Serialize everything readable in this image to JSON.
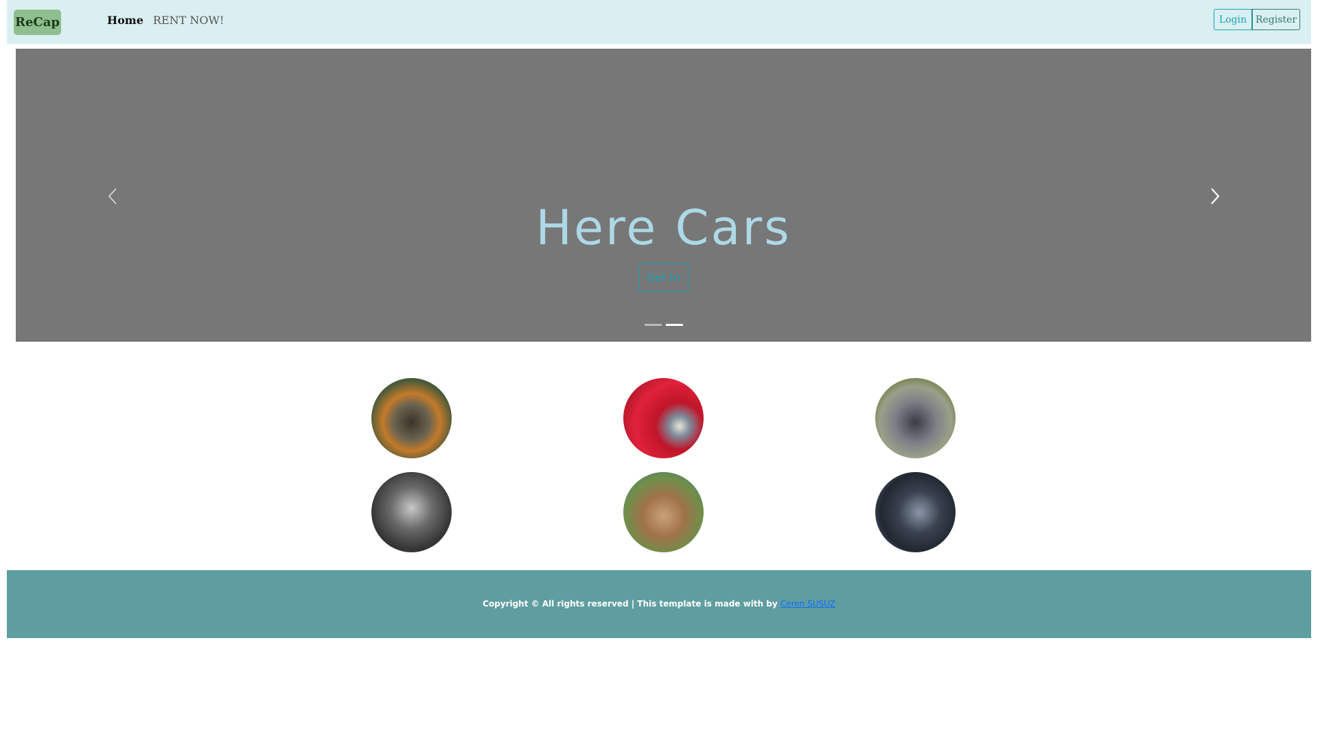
{
  "navbar": {
    "brand": "ReCap",
    "links": [
      {
        "label": "Home"
      },
      {
        "label": "RENT NOW!"
      }
    ],
    "login_label": "Login",
    "register_label": "Register",
    "background_color": "#daeff1"
  },
  "carousel": {
    "title": "Here Cars",
    "button_label": "Get In",
    "prev_icon": "chevron-left-icon",
    "next_icon": "chevron-right-icon",
    "slide_count": 2,
    "active_slide": 2,
    "background_color": "#777777",
    "title_color": "#add8e6"
  },
  "gallery": {
    "items": [
      {
        "name": "car-image-1"
      },
      {
        "name": "car-image-2"
      },
      {
        "name": "car-image-3"
      },
      {
        "name": "car-image-4"
      },
      {
        "name": "car-image-5"
      },
      {
        "name": "car-image-6"
      }
    ]
  },
  "footer": {
    "text": "Copyright © All rights reserved | This template is made with by ",
    "link_label": "Ceren SUSUZ",
    "background_color": "#5f9ea0"
  }
}
